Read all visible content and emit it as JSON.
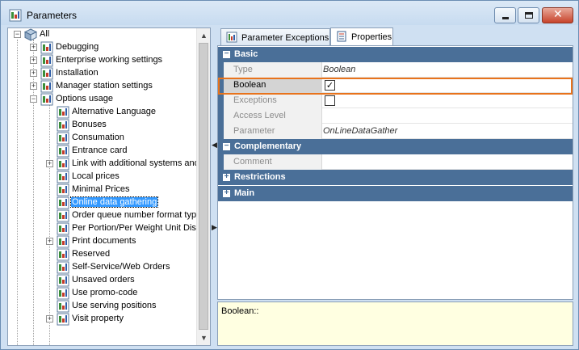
{
  "window": {
    "title": "Parameters"
  },
  "tree": {
    "nodes": [
      {
        "label": "All"
      },
      {
        "label": "Debugging"
      },
      {
        "label": "Enterprise working settings"
      },
      {
        "label": "Installation"
      },
      {
        "label": "Manager station settings"
      },
      {
        "label": "Options usage"
      },
      {
        "label": "Alternative Language"
      },
      {
        "label": "Bonuses"
      },
      {
        "label": "Consumation"
      },
      {
        "label": "Entrance card"
      },
      {
        "label": "Link with additional systems and"
      },
      {
        "label": "Local prices"
      },
      {
        "label": "Minimal Prices"
      },
      {
        "label": "Online data gathering"
      },
      {
        "label": "Order queue number format type"
      },
      {
        "label": "Per Portion/Per Weight Unit Dis"
      },
      {
        "label": "Print documents"
      },
      {
        "label": "Reserved"
      },
      {
        "label": "Self-Service/Web Orders"
      },
      {
        "label": "Unsaved orders"
      },
      {
        "label": "Use promo-code"
      },
      {
        "label": "Use serving positions"
      },
      {
        "label": "Visit property"
      }
    ]
  },
  "tabs": [
    {
      "label": "Parameter Exceptions"
    },
    {
      "label": "Properties"
    }
  ],
  "grid": {
    "categories": {
      "basic": "Basic",
      "complementary": "Complementary",
      "restrictions": "Restrictions",
      "main": "Main"
    },
    "rows": {
      "type": {
        "name": "Type",
        "value": "Boolean"
      },
      "boolean": {
        "name": "Boolean",
        "checked": true
      },
      "exceptions": {
        "name": "Exceptions",
        "checked": false
      },
      "access_level": {
        "name": "Access Level",
        "value": ""
      },
      "parameter": {
        "name": "Parameter",
        "value": "OnLineDataGather"
      },
      "comment": {
        "name": "Comment",
        "value": ""
      }
    }
  },
  "description": "Boolean::",
  "colors": {
    "category_header": "#4a6f98",
    "selection": "#3399ff",
    "highlight_border": "#e8731c",
    "description_bg": "#ffffe1"
  }
}
